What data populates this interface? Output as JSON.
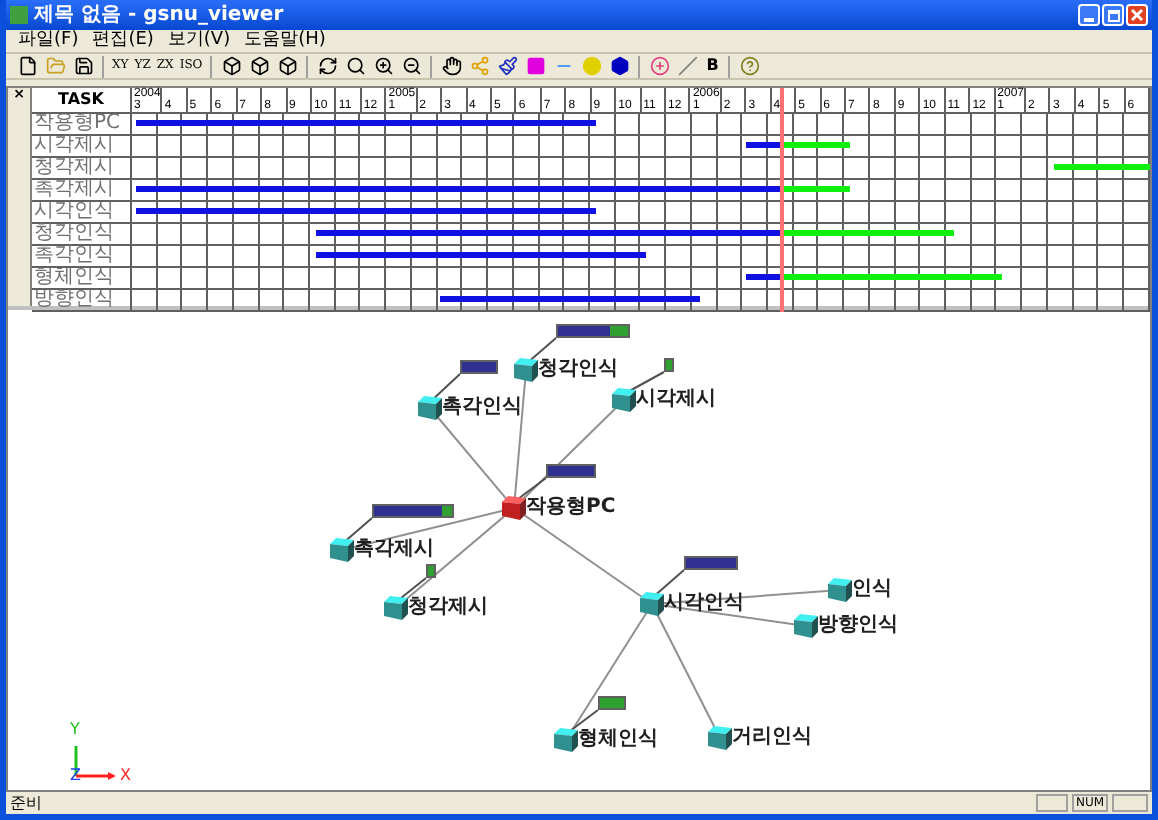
{
  "window": {
    "title": "제목 없음 - gsnu_viewer"
  },
  "menu": [
    "파일(F)",
    "편집(E)",
    "보기(V)",
    "도움말(H)"
  ],
  "toolbar": {
    "view_buttons": [
      "XY",
      "YZ",
      "ZX",
      "ISO"
    ],
    "bold_button": "B"
  },
  "gantt": {
    "corner": "×",
    "task_header": "TASK",
    "years": [
      {
        "year": "2004",
        "months": [
          "3",
          "4",
          "5",
          "6",
          "7",
          "8",
          "9",
          "10",
          "11",
          "12"
        ]
      },
      {
        "year": "2005",
        "months": [
          "1",
          "2",
          "3",
          "4",
          "5",
          "6",
          "7",
          "8",
          "9",
          "10",
          "11",
          "12"
        ]
      },
      {
        "year": "2006",
        "months": [
          "1",
          "2",
          "3",
          "4",
          "5",
          "6",
          "7",
          "8",
          "9",
          "10",
          "11",
          "12"
        ]
      },
      {
        "year": "2007",
        "months": [
          "1",
          "2",
          "3",
          "4",
          "5",
          "6"
        ]
      }
    ],
    "tasks": [
      {
        "name": "작용형PC",
        "bars": [
          {
            "kind": "done"
          }
        ]
      },
      {
        "name": "시각제시",
        "bars": [
          {
            "kind": "done"
          },
          {
            "kind": "planned"
          }
        ]
      },
      {
        "name": "청각제시",
        "bars": [
          {
            "kind": "planned"
          }
        ]
      },
      {
        "name": "촉각제시",
        "bars": [
          {
            "kind": "done"
          },
          {
            "kind": "planned"
          }
        ]
      },
      {
        "name": "시각인식",
        "bars": [
          {
            "kind": "done"
          }
        ]
      },
      {
        "name": "청각인식",
        "bars": [
          {
            "kind": "done"
          },
          {
            "kind": "planned"
          }
        ]
      },
      {
        "name": "촉각인식",
        "bars": [
          {
            "kind": "done"
          }
        ]
      },
      {
        "name": "형체인식",
        "bars": [
          {
            "kind": "done"
          },
          {
            "kind": "planned"
          }
        ]
      },
      {
        "name": "방향인식",
        "bars": [
          {
            "kind": "done"
          }
        ]
      }
    ]
  },
  "graph": {
    "root": {
      "label": "작용형PC",
      "kind": "root",
      "bar": {
        "level": 1
      },
      "children": [
        {
          "label": "촉각인식",
          "kind": "node",
          "bar": {
            "level": 1
          }
        },
        {
          "label": "청각인식",
          "kind": "node",
          "bar": {
            "level": 0.73
          }
        },
        {
          "label": "시각제시",
          "kind": "node",
          "bar": {
            "planned": true
          }
        },
        {
          "label": "촉각제시",
          "kind": "node",
          "bar": {
            "level": 0.88
          }
        },
        {
          "label": "청각제시",
          "kind": "node",
          "bar": {
            "planned": true
          }
        },
        {
          "label": "시각인식",
          "kind": "node",
          "bar": {
            "level": 1
          },
          "children": [
            {
              "label": "인식",
              "kind": "node"
            },
            {
              "label": "방향인식",
              "kind": "node"
            },
            {
              "label": "형체인식",
              "kind": "node",
              "bar": {
                "planned": true
              }
            },
            {
              "label": "거리인식",
              "kind": "node"
            }
          ]
        }
      ]
    },
    "axes": {
      "y": "Y",
      "z": "Z",
      "x": "X"
    }
  },
  "status_bar": {
    "message": "준비",
    "indicator": "NUM"
  }
}
